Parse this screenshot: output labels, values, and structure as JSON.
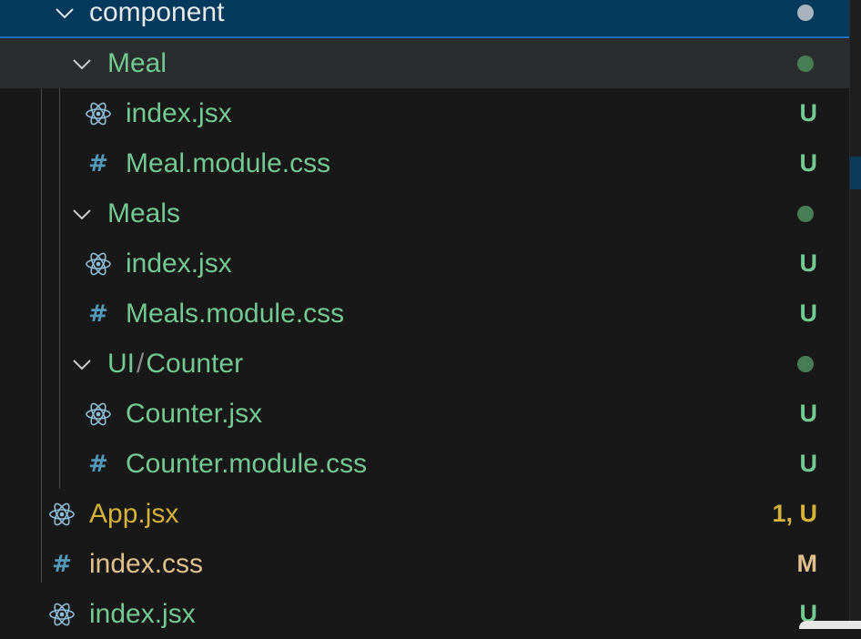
{
  "explorer": {
    "items": [
      {
        "label": "component",
        "kind": "folder",
        "status": "",
        "indicator": "dot-grey"
      },
      {
        "label": "Meal",
        "kind": "folder",
        "status": "",
        "indicator": "dot-green"
      },
      {
        "label": "index.jsx",
        "kind": "react",
        "status": "U"
      },
      {
        "label": "Meal.module.css",
        "kind": "css",
        "status": "U"
      },
      {
        "label": "Meals",
        "kind": "folder",
        "status": "",
        "indicator": "dot-green"
      },
      {
        "label": "index.jsx",
        "kind": "react",
        "status": "U"
      },
      {
        "label": "Meals.module.css",
        "kind": "css",
        "status": "U"
      },
      {
        "label_part1": "UI",
        "separator": "/",
        "label_part2": "Counter",
        "kind": "folder",
        "status": "",
        "indicator": "dot-green"
      },
      {
        "label": "Counter.jsx",
        "kind": "react",
        "status": "U"
      },
      {
        "label": "Counter.module.css",
        "kind": "css",
        "status": "U"
      },
      {
        "label": "App.jsx",
        "kind": "react",
        "status": "1, U"
      },
      {
        "label": "index.css",
        "kind": "css",
        "status": "M"
      },
      {
        "label": "index.jsx",
        "kind": "react",
        "status": "U"
      }
    ]
  },
  "colors": {
    "untracked": "#73c991",
    "warning": "#d4b23a",
    "modified": "#e2c08d",
    "selected_bg": "#04395e"
  },
  "icons": {
    "folder_open": "chevron-down-icon",
    "react_file": "react-icon",
    "css_file": "hash-icon"
  }
}
